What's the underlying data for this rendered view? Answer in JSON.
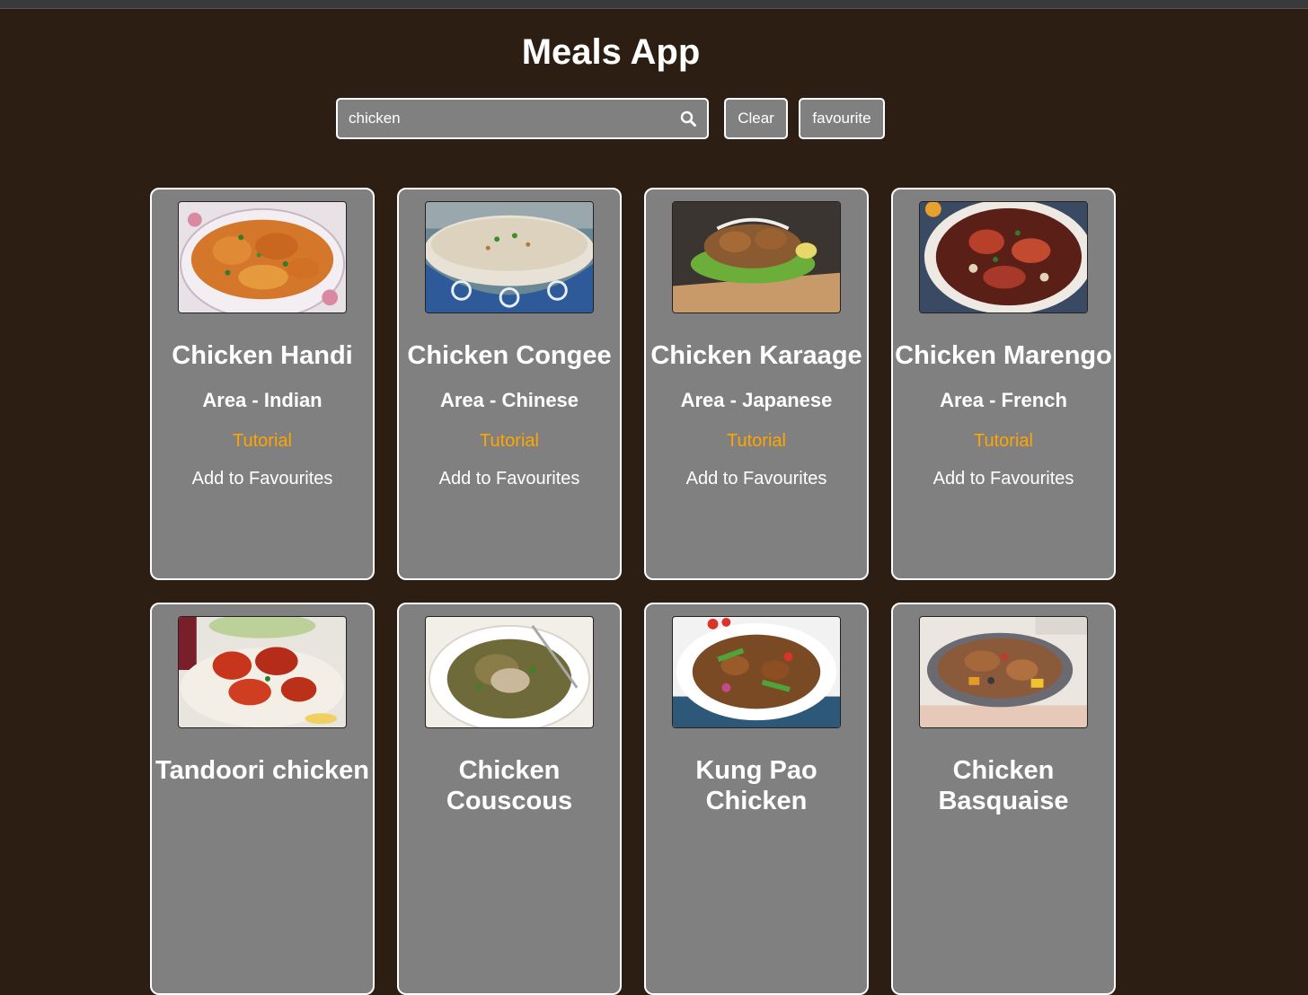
{
  "app": {
    "title": "Meals App"
  },
  "search": {
    "value": "chicken",
    "placeholder": "",
    "icon": "search-icon"
  },
  "buttons": {
    "clear_label": "Clear",
    "favourite_label": "favourite"
  },
  "colors": {
    "background": "#2c1e12",
    "card": "#808080",
    "tutorial_link": "#ffa500"
  },
  "meals": [
    {
      "name": "Chicken Handi",
      "area": "Area - Indian",
      "tutorial": "Tutorial",
      "favourite": "Add to Favourites"
    },
    {
      "name": "Chicken Congee",
      "area": "Area - Chinese",
      "tutorial": "Tutorial",
      "favourite": "Add to Favourites"
    },
    {
      "name": "Chicken Karaage",
      "area": "Area - Japanese",
      "tutorial": "Tutorial",
      "favourite": "Add to Favourites"
    },
    {
      "name": "Chicken Marengo",
      "area": "Area - French",
      "tutorial": "Tutorial",
      "favourite": "Add to Favourites"
    },
    {
      "name": "Tandoori chicken",
      "area": "",
      "tutorial": "",
      "favourite": ""
    },
    {
      "name": "Chicken Couscous",
      "area": "",
      "tutorial": "",
      "favourite": ""
    },
    {
      "name": "Kung Pao Chicken",
      "area": "",
      "tutorial": "",
      "favourite": ""
    },
    {
      "name": "Chicken Basquaise",
      "area": "",
      "tutorial": "",
      "favourite": ""
    }
  ]
}
